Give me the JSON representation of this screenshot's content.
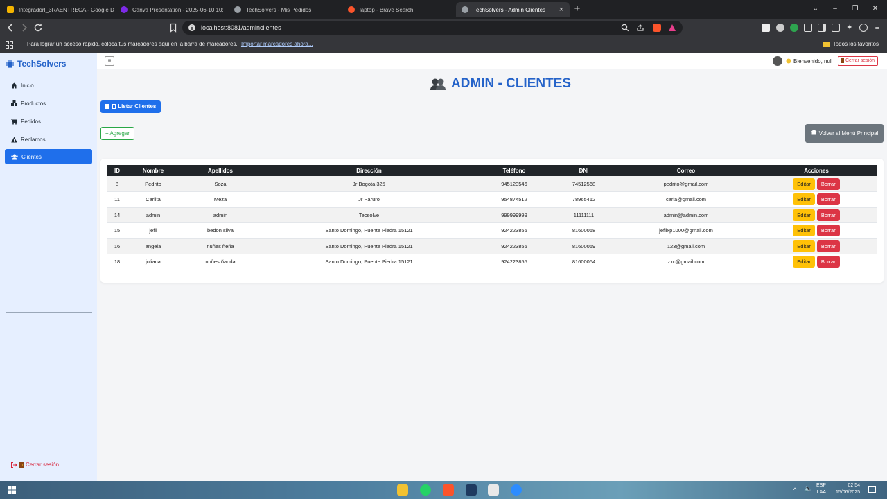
{
  "browser": {
    "tabs": [
      {
        "title": "IntegradorI_3RAENTREGA - Google D",
        "color": "#f4b400"
      },
      {
        "title": "Canva Presentation - 2025-06-10 10:",
        "color": "#7d2ae8"
      },
      {
        "title": "TechSolvers - Mis Pedidos",
        "color": "#9aa0a6"
      },
      {
        "title": "laptop - Brave Search",
        "color": "#fb542b"
      },
      {
        "title": "TechSolvers - Admin Clientes",
        "color": "#9aa0a6"
      }
    ],
    "url": "localhost:8081/adminclientes",
    "bookmarks_text": "Para lograr un acceso rápido, coloca tus marcadores aquí en la barra de marcadores.",
    "bookmarks_link": "Importar marcadores ahora...",
    "bookmarks_all": "Todos los favoritos"
  },
  "sidebar": {
    "brand": "TechSolvers",
    "items": [
      {
        "label": "Inicio"
      },
      {
        "label": "Productos"
      },
      {
        "label": "Pedidos"
      },
      {
        "label": "Reclamos"
      },
      {
        "label": "Clientes"
      }
    ],
    "logout": "Cerrar sesión"
  },
  "topbar": {
    "welcome": "Bienvenido, null",
    "logout": "Cerrar sesión"
  },
  "page": {
    "title": "ADMIN - CLIENTES",
    "list_button": "Listar Clientes",
    "add_button": "+ Agregar",
    "back_button": "Volver al Menú Principal"
  },
  "table": {
    "headers": [
      "ID",
      "Nombre",
      "Apellidos",
      "Dirección",
      "Teléfono",
      "DNI",
      "Correo",
      "Acciones"
    ],
    "edit_label": "Editar",
    "delete_label": "Borrar",
    "rows": [
      {
        "id": "8",
        "nombre": "Pedrito",
        "apellidos": "Soza",
        "direccion": "Jr Bogota 325",
        "telefono": "945123546",
        "dni": "74512568",
        "correo": "pedrito@gmail.com"
      },
      {
        "id": "11",
        "nombre": "Carlita",
        "apellidos": "Meza",
        "direccion": "Jr Paruro",
        "telefono": "954874512",
        "dni": "78965412",
        "correo": "carla@gmail.com"
      },
      {
        "id": "14",
        "nombre": "admin",
        "apellidos": "admin",
        "direccion": "Tecsolve",
        "telefono": "999999999",
        "dni": "11111111",
        "correo": "admin@admin.com"
      },
      {
        "id": "15",
        "nombre": "jefii",
        "apellidos": "bedon silva",
        "direccion": "Santo Domingo, Puente Piedra 15121",
        "telefono": "924223855",
        "dni": "81600058",
        "correo": "jefiixp1000@gmail.com"
      },
      {
        "id": "16",
        "nombre": "angela",
        "apellidos": "nuñes ñeña",
        "direccion": "Santo Domingo, Puente Piedra 15121",
        "telefono": "924223855",
        "dni": "81600059",
        "correo": "123@gmail.com"
      },
      {
        "id": "18",
        "nombre": "juliana",
        "apellidos": "nuñes ñanda",
        "direccion": "Santo Domingo, Puente Piedra 15121",
        "telefono": "924223855",
        "dni": "81600054",
        "correo": "zxc@gmail.com"
      }
    ]
  },
  "taskbar": {
    "lang1": "ESP",
    "lang2": "LAA",
    "time": "02:54",
    "date": "15/06/2025"
  },
  "colors": {
    "primary": "#1f6feb",
    "title": "#2563c9",
    "edit": "#ffc107",
    "delete": "#dc3545",
    "add": "#28a745",
    "back": "#6c757d"
  }
}
